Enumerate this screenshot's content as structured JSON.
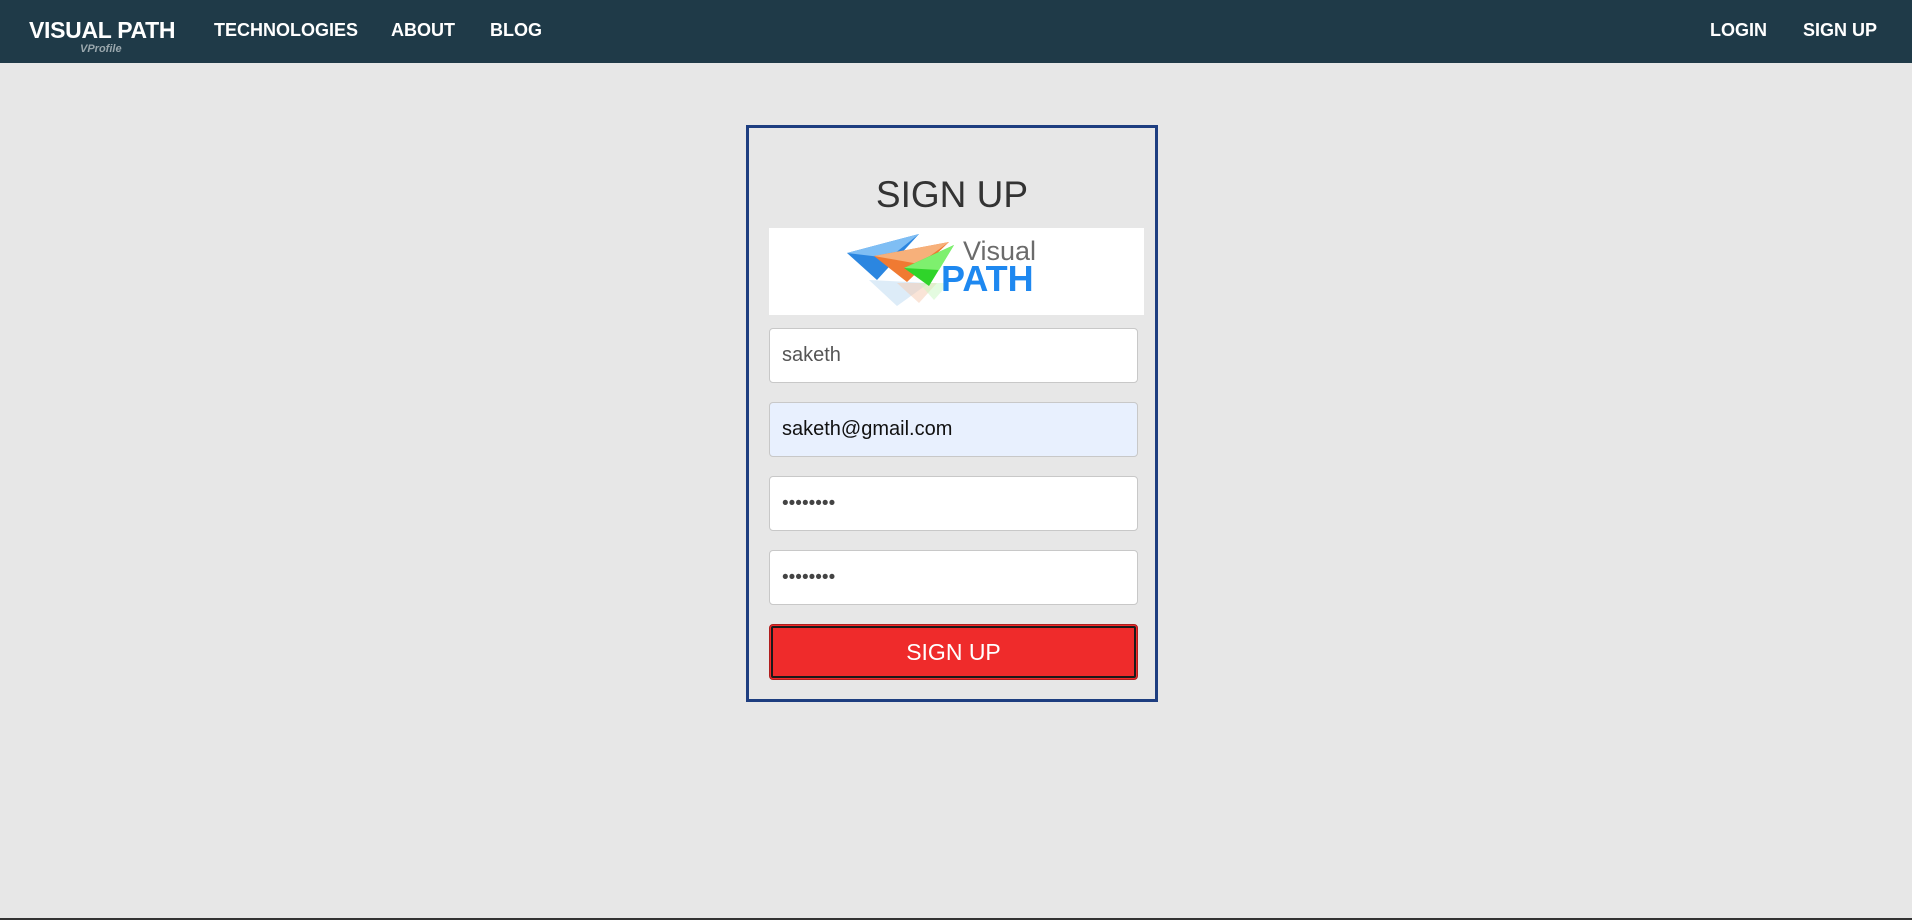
{
  "navbar": {
    "brand": "VISUAL PATH",
    "brand_sub": "VProfile",
    "links": [
      "TECHNOLOGIES",
      "ABOUT",
      "BLOG"
    ],
    "login": "LOGIN",
    "signup": "SIGN UP"
  },
  "form": {
    "title": "SIGN UP",
    "logo_text_top": "Visual",
    "logo_text_bottom": "PATH",
    "username_value": "saketh",
    "email_value": "saketh@gmail.com",
    "password_value": "••••••••",
    "confirm_password_value": "••••••••",
    "submit_label": "SIGN UP"
  },
  "colors": {
    "navbar_bg": "#1f3a48",
    "page_bg": "#e7e7e7",
    "panel_border": "#1e3e80",
    "submit_bg": "#ef2b2b",
    "autofill_bg": "#e8f0fe"
  }
}
